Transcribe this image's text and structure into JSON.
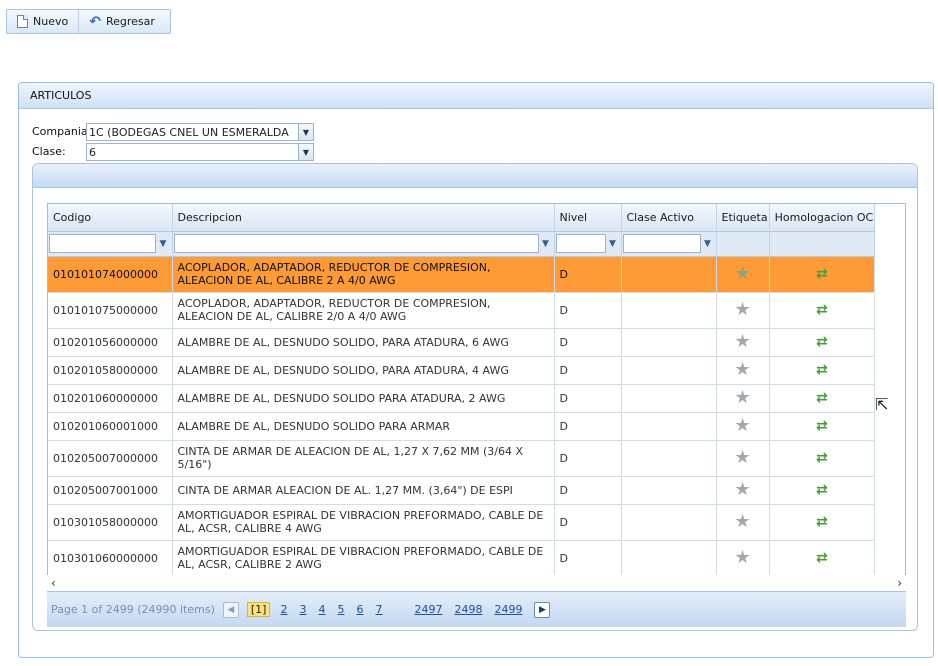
{
  "toolbar": {
    "new_label": "Nuevo",
    "back_label": "Regresar"
  },
  "panel": {
    "title": "ARTICULOS",
    "company_label": "Compania:",
    "company_value": "1C (BODEGAS CNEL UN ESMERALDA",
    "class_label": "Clase:",
    "class_value": "6"
  },
  "grid": {
    "columns": [
      "Codigo",
      "Descripcion",
      "Nivel",
      "Clase Activo",
      "Etiqueta",
      "Homologacion OC"
    ],
    "rows": [
      {
        "codigo": "010101074000000",
        "descripcion": "ACOPLADOR, ADAPTADOR, REDUCTOR DE COMPRESION, ALEACION DE AL, CALIBRE 2 A 4/0 AWG",
        "nivel": "D",
        "clase": ""
      },
      {
        "codigo": "010101075000000",
        "descripcion": "ACOPLADOR, ADAPTADOR, REDUCTOR DE COMPRESION, ALEACION DE AL, CALIBRE 2/0 A 4/0 AWG",
        "nivel": "D",
        "clase": ""
      },
      {
        "codigo": "010201056000000",
        "descripcion": "ALAMBRE DE AL, DESNUDO SOLIDO, PARA ATADURA, 6 AWG",
        "nivel": "D",
        "clase": ""
      },
      {
        "codigo": "010201058000000",
        "descripcion": "ALAMBRE DE AL, DESNUDO SOLIDO, PARA ATADURA, 4 AWG",
        "nivel": "D",
        "clase": ""
      },
      {
        "codigo": "010201060000000",
        "descripcion": "ALAMBRE DE AL, DESNUDO SOLIDO PARA ATADURA, 2 AWG",
        "nivel": "D",
        "clase": ""
      },
      {
        "codigo": "010201060001000",
        "descripcion": "ALAMBRE DE AL, DESNUDO SOLIDO PARA ARMAR",
        "nivel": "D",
        "clase": ""
      },
      {
        "codigo": "010205007000000",
        "descripcion": "CINTA DE ARMAR DE ALEACION DE AL, 1,27 X 7,62 MM (3/64 X 5/16\")",
        "nivel": "D",
        "clase": ""
      },
      {
        "codigo": "010205007001000",
        "descripcion": "CINTA DE ARMAR ALEACION DE AL. 1,27 MM. (3,64\") DE ESPI",
        "nivel": "D",
        "clase": ""
      },
      {
        "codigo": "010301058000000",
        "descripcion": "AMORTIGUADOR ESPIRAL DE VIBRACION PREFORMADO, CABLE DE AL, ACSR, CALIBRE 4 AWG",
        "nivel": "D",
        "clase": ""
      },
      {
        "codigo": "010301060000000",
        "descripcion": "AMORTIGUADOR ESPIRAL DE VIBRACION PREFORMADO, CABLE DE AL, ACSR, CALIBRE 2 AWG",
        "nivel": "D",
        "clase": ""
      }
    ],
    "selected_row": 0,
    "selected_color": "#fe9b36"
  },
  "pager": {
    "info": "Page 1 of 2499 (24990 items)",
    "current": "[1]",
    "pages": [
      "2",
      "3",
      "4",
      "5",
      "6",
      "7"
    ],
    "last_pages": [
      "2497",
      "2498",
      "2499"
    ]
  },
  "icons": {
    "prev": "chevron-left-icon",
    "next": "chevron-right-icon",
    "etiqueta": "star-icon",
    "homologacion": "swap-arrows-icon"
  }
}
